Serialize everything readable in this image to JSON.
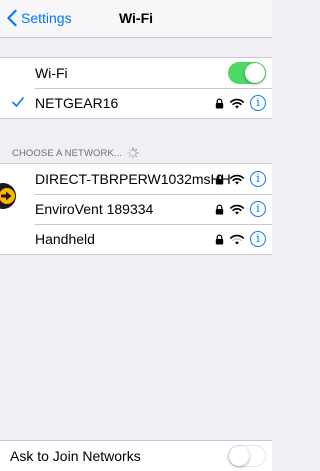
{
  "nav": {
    "back_label": "Settings",
    "title": "Wi-Fi"
  },
  "wifi_toggle": {
    "label": "Wi-Fi",
    "state": "on"
  },
  "connected": {
    "name": "NETGEAR16",
    "secured": true
  },
  "networks_header": "CHOOSE A NETWORK...",
  "networks": [
    {
      "name": "DIRECT-TBRPERW1032msHH",
      "secured": true
    },
    {
      "name": "EnviroVent 189334",
      "secured": true
    },
    {
      "name": "Handheld",
      "secured": true
    }
  ],
  "ask_to_join": {
    "label": "Ask to Join Networks",
    "state": "off"
  },
  "info_glyph": "i",
  "colors": {
    "accent": "#007aff",
    "toggle_on": "#4cd964",
    "background": "#efeff4"
  },
  "icons": [
    "chevron-left-icon",
    "checkmark-icon",
    "lock-icon",
    "wifi-icon",
    "info-icon",
    "spinner-icon",
    "arrow-right-icon"
  ]
}
